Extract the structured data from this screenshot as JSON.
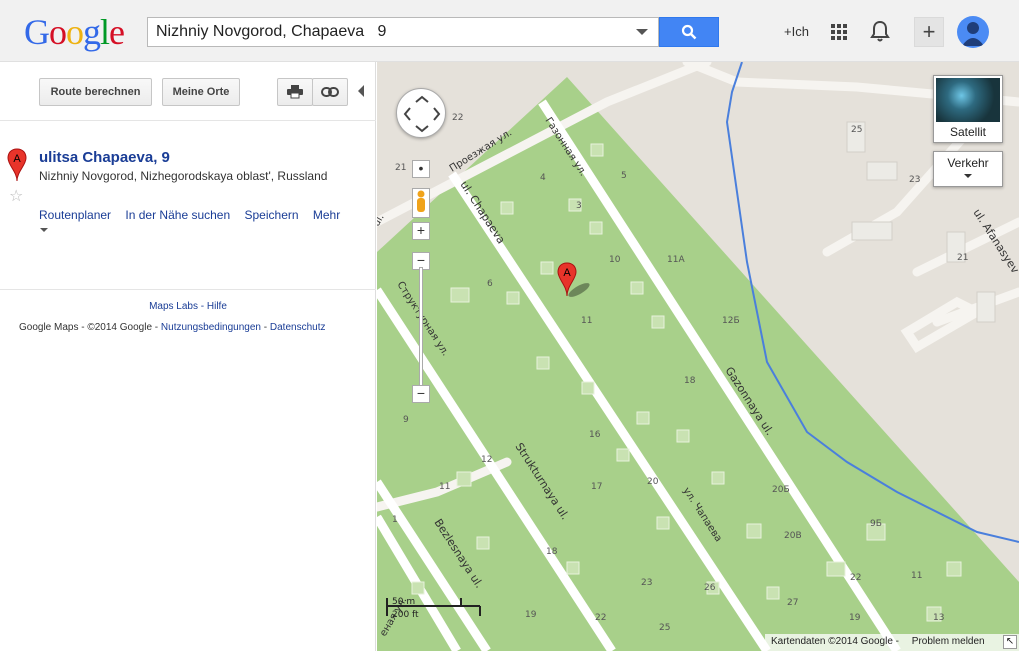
{
  "header": {
    "logo": "Google",
    "search_value": "Nizhniy Novgorod, Chapaeva   9",
    "user_link": "+Ich",
    "colors": {
      "search_button": "#4285f4",
      "logo_blue": "#3369e8",
      "logo_red": "#d50f25",
      "logo_yellow": "#eeb211",
      "logo_green": "#009925"
    }
  },
  "panel": {
    "route_button": "Route berechnen",
    "places_button": "Meine Orte",
    "result": {
      "marker_letter": "A",
      "title": "ulitsa Chapaeva, 9",
      "address": "Nizhniy Novgorod, Nizhegorodskaya oblast', Russland",
      "links": [
        "Routenplaner",
        "In der Nähe suchen",
        "Speichern",
        "Mehr"
      ]
    },
    "footer": {
      "labs": "Maps Labs",
      "sep": " - ",
      "help": "Hilfe",
      "brand": "Google Maps",
      "copyright": " - ©2014 Google - ",
      "terms": "Nutzungsbedingungen",
      "privacy": "Datenschutz"
    }
  },
  "map": {
    "satellite_label": "Satellit",
    "traffic_label": "Verkehr",
    "marker_letter": "A",
    "scale_metric": "50 m",
    "scale_imperial": "200 ft",
    "attribution": "Kartendaten ©2014 Google -",
    "report": "Problem melden",
    "street_labels": {
      "proezzhaya": "Проезжая ул.",
      "gazonnaya_ru": "Газонная ул.",
      "chapaeva": "ul. Chapaeva",
      "strukturnaya_ru": "Структурная ул.",
      "gazonnaya": "Gazonnaya ul.",
      "strukturnaya": "Strukturnaya ul.",
      "chapaeva_ru": "ул. Чапаева",
      "bezlesnaya": "Bezlesnaya ul.",
      "afanasyeva": "ul. Afanasyev",
      "ul_left": "ul.",
      "ul_bottom": "еная ул."
    },
    "house_numbers": [
      "22",
      "21",
      "4",
      "5",
      "3",
      "10",
      "11А",
      "6",
      "11",
      "12Б",
      "18",
      "25",
      "23",
      "21",
      "9",
      "16",
      "12",
      "17",
      "11",
      "20",
      "20Б",
      "20В",
      "9Б",
      "22",
      "11",
      "18",
      "23",
      "26",
      "27",
      "19",
      "22",
      "25",
      "19",
      "13",
      "1"
    ],
    "colors": {
      "park": "#a8d08a",
      "land": "#e5e1da",
      "road": "#ffffff",
      "river": "#4a7fdc"
    }
  }
}
